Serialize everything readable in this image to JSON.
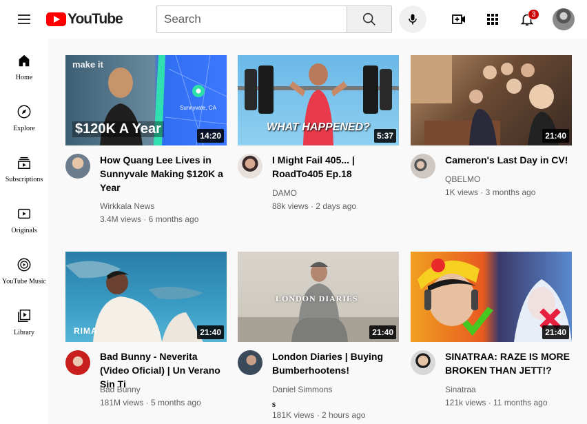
{
  "header": {
    "logo_text": "YouTube",
    "search_placeholder": "Search",
    "notification_count": "3"
  },
  "sidebar": {
    "items": [
      {
        "label": "Home",
        "icon": "home-icon"
      },
      {
        "label": "Explore",
        "icon": "compass-icon"
      },
      {
        "label": "Subscriptions",
        "icon": "subscriptions-icon"
      },
      {
        "label": "Originals",
        "icon": "originals-icon"
      },
      {
        "label": "YouTube Music",
        "icon": "music-icon"
      },
      {
        "label": "Library",
        "icon": "library-icon"
      }
    ]
  },
  "videos": [
    {
      "title": "How Quang Lee Lives in Sunnyvale Making $120K a Year",
      "channel": "Wirkkala News",
      "meta": "3.4M views · 6 months ago",
      "duration": "14:20",
      "thumb_texts": [
        "make it",
        "Sunnyvale, CA",
        "$120K A Year"
      ]
    },
    {
      "title": "I Might Fail 405... | RoadTo405 Ep.18",
      "channel": "DAMO",
      "meta": "88k views · 2 days ago",
      "duration": "5:37",
      "thumb_texts": [
        "WHAT HAPPENED?"
      ]
    },
    {
      "title": "Cameron's Last Day in CV!",
      "channel": "QBELMO",
      "meta": "1K views · 3 months ago",
      "duration": "21:40",
      "thumb_texts": []
    },
    {
      "title": "Bad Bunny - Neverita (Video Oficial) | Un Verano Sin Ti",
      "channel": "Bad Bunny",
      "meta": "181M views · 5 months ago",
      "duration": "21:40",
      "thumb_texts": [
        "RIMA"
      ]
    },
    {
      "title": "London Diaries | Buying Bumberhootens!",
      "channel": "Daniel Simmons",
      "extra": "s",
      "meta": "181K views · 2 hours ago",
      "duration": "21:40",
      "thumb_texts": [
        "LONDON DIARIES"
      ]
    },
    {
      "title": "SINATRAA: RAZE IS MORE BROKEN THAN JETT!?",
      "channel": "Sinatraa",
      "meta": "121k views · 11 months ago",
      "duration": "21:40",
      "thumb_texts": []
    }
  ]
}
